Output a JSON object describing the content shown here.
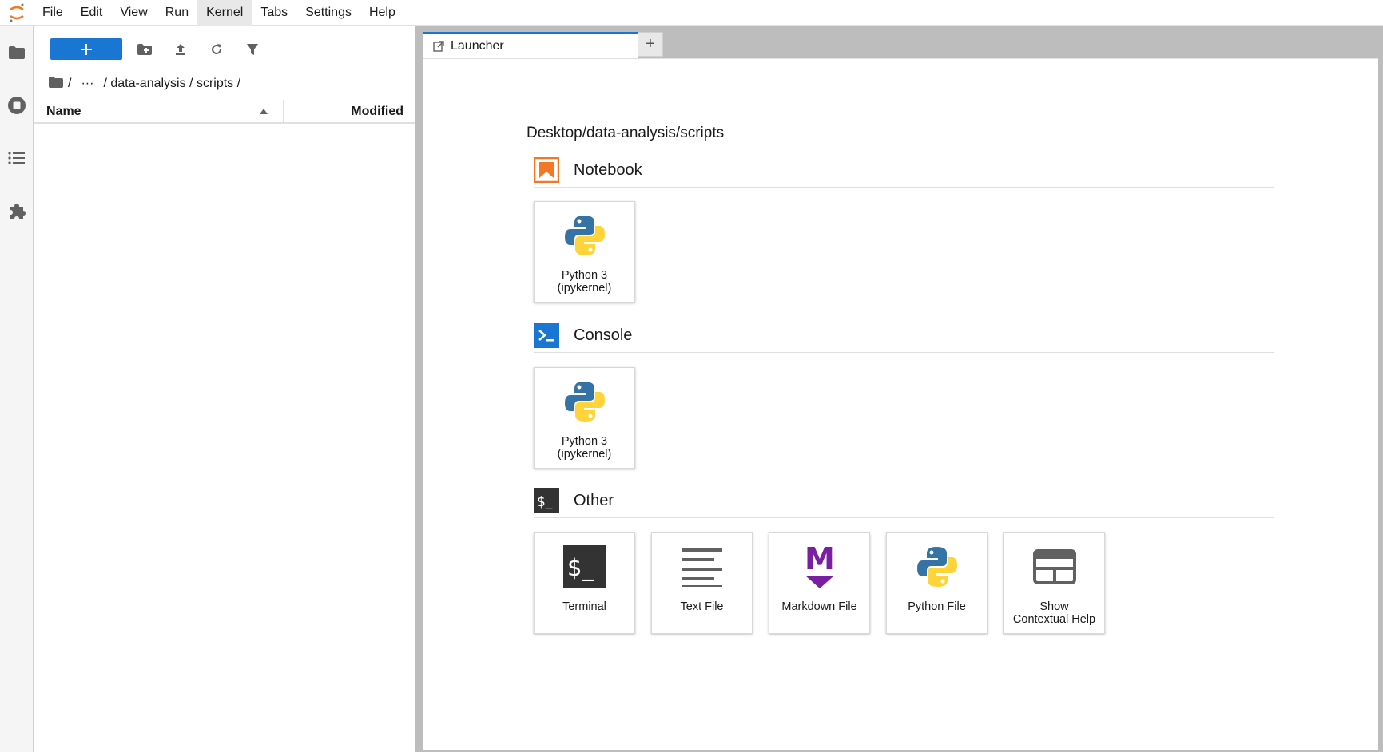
{
  "menubar": {
    "items": [
      "File",
      "Edit",
      "View",
      "Run",
      "Kernel",
      "Tabs",
      "Settings",
      "Help"
    ],
    "active": "Kernel"
  },
  "activitybar": {
    "icons": [
      "folder-icon",
      "running-sessions-icon",
      "table-of-contents-icon",
      "extensions-icon"
    ]
  },
  "filebrowser": {
    "breadcrumb": {
      "root_sep": "/",
      "ellipsis": "···",
      "path": "/ data-analysis / scripts /"
    },
    "columns": {
      "name": "Name",
      "modified": "Modified"
    }
  },
  "tabs": {
    "launcher_label": "Launcher",
    "add_label": "+"
  },
  "launcher": {
    "path": "Desktop/data-analysis/scripts",
    "sections": {
      "notebook": {
        "title": "Notebook",
        "cards": [
          {
            "label": "Python 3\n(ipykernel)"
          }
        ]
      },
      "console": {
        "title": "Console",
        "cards": [
          {
            "label": "Python 3\n(ipykernel)"
          }
        ]
      },
      "other": {
        "title": "Other",
        "cards": [
          {
            "label": "Terminal"
          },
          {
            "label": "Text File"
          },
          {
            "label": "Markdown File"
          },
          {
            "label": "Python File"
          },
          {
            "label": "Show\nContextual Help"
          }
        ]
      }
    }
  },
  "colors": {
    "accent": "#1976d2",
    "notebook_orange": "#f37726",
    "markdown_purple": "#7b1fa2",
    "python_blue": "#3572a5",
    "python_yellow": "#ffd43b"
  }
}
